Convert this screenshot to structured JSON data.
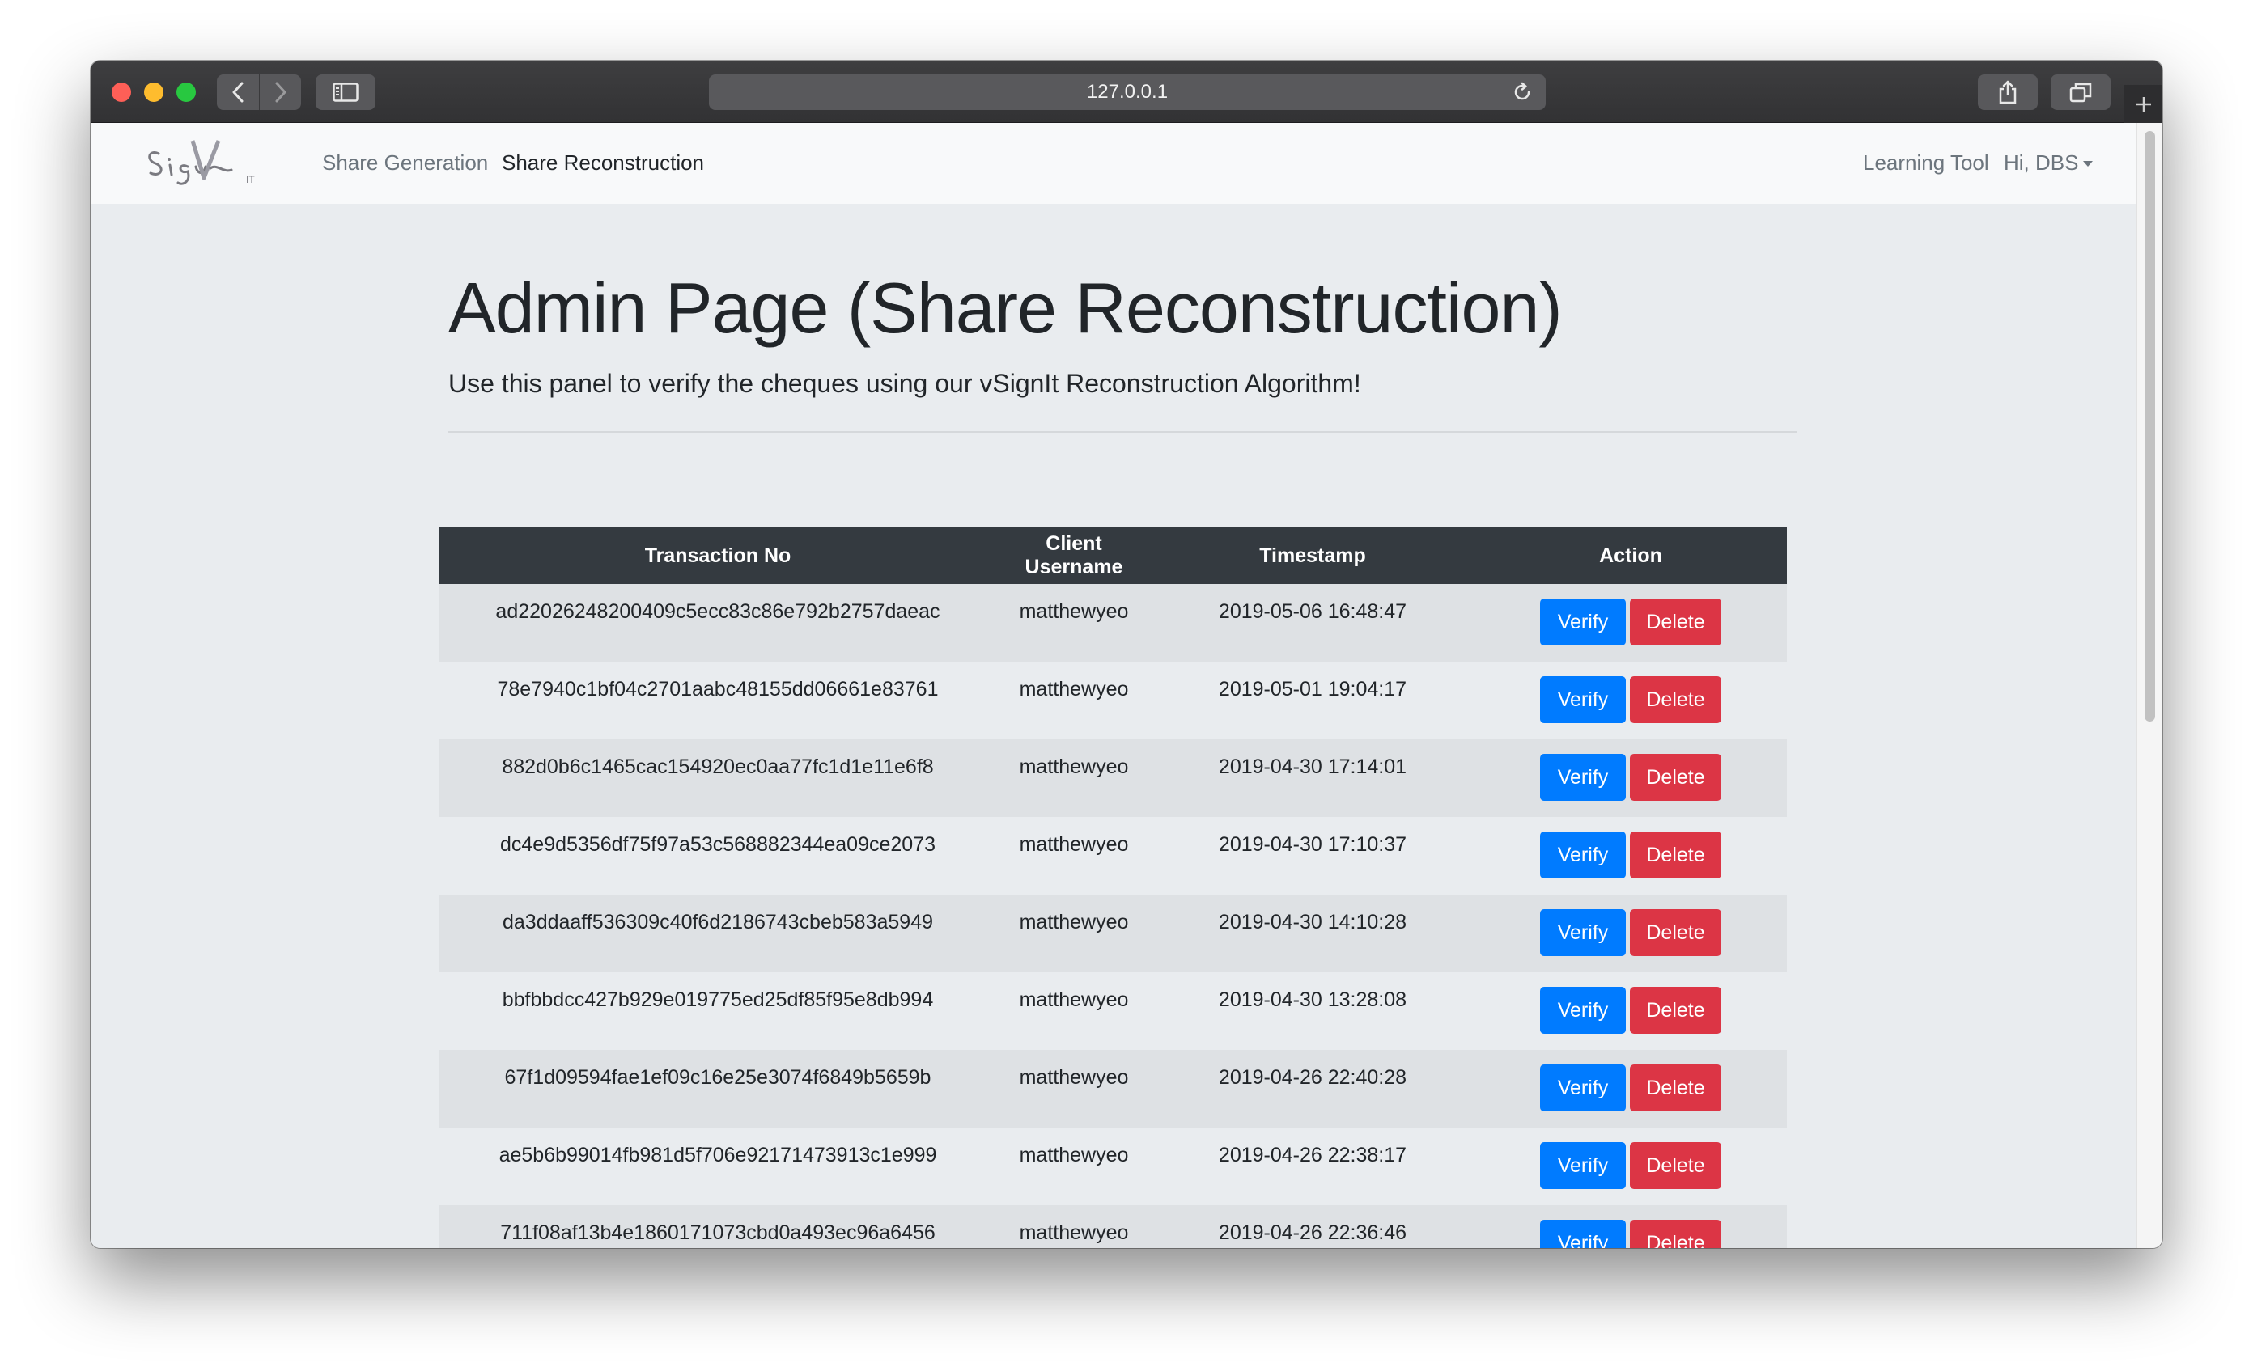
{
  "browser": {
    "url": "127.0.0.1"
  },
  "navbar": {
    "brand": "vSignIt",
    "links": {
      "share_generation": "Share Generation",
      "share_reconstruction": "Share Reconstruction",
      "learning_tool": "Learning Tool",
      "user_menu": "Hi, DBS"
    }
  },
  "main": {
    "title": "Admin Page (Share Reconstruction)",
    "lead": "Use this panel to verify the cheques using our vSignIt Reconstruction Algorithm!"
  },
  "table": {
    "columns": [
      "Transaction No",
      "Client Username",
      "Timestamp",
      "Action"
    ],
    "verify_label": "Verify",
    "delete_label": "Delete",
    "rows": [
      {
        "txn": "ad22026248200409c5ecc83c86e792b2757daeac",
        "user": "matthewyeo",
        "ts": "2019-05-06 16:48:47"
      },
      {
        "txn": "78e7940c1bf04c2701aabc48155dd06661e83761",
        "user": "matthewyeo",
        "ts": "2019-05-01 19:04:17"
      },
      {
        "txn": "882d0b6c1465cac154920ec0aa77fc1d1e11e6f8",
        "user": "matthewyeo",
        "ts": "2019-04-30 17:14:01"
      },
      {
        "txn": "dc4e9d5356df75f97a53c568882344ea09ce2073",
        "user": "matthewyeo",
        "ts": "2019-04-30 17:10:37"
      },
      {
        "txn": "da3ddaaff536309c40f6d2186743cbeb583a5949",
        "user": "matthewyeo",
        "ts": "2019-04-30 14:10:28"
      },
      {
        "txn": "bbfbbdcc427b929e019775ed25df85f95e8db994",
        "user": "matthewyeo",
        "ts": "2019-04-30 13:28:08"
      },
      {
        "txn": "67f1d09594fae1ef09c16e25e3074f6849b5659b",
        "user": "matthewyeo",
        "ts": "2019-04-26 22:40:28"
      },
      {
        "txn": "ae5b6b99014fb981d5f706e92171473913c1e999",
        "user": "matthewyeo",
        "ts": "2019-04-26 22:38:17"
      },
      {
        "txn": "711f08af13b4e1860171073cbd0a493ec96a6456",
        "user": "matthewyeo",
        "ts": "2019-04-26 22:36:46"
      },
      {
        "txn": "",
        "user": "",
        "ts": ""
      }
    ]
  },
  "colors": {
    "verify": "#007bff",
    "delete": "#dc3545",
    "table_header": "#343a40",
    "page_bg": "#e9ecef"
  }
}
